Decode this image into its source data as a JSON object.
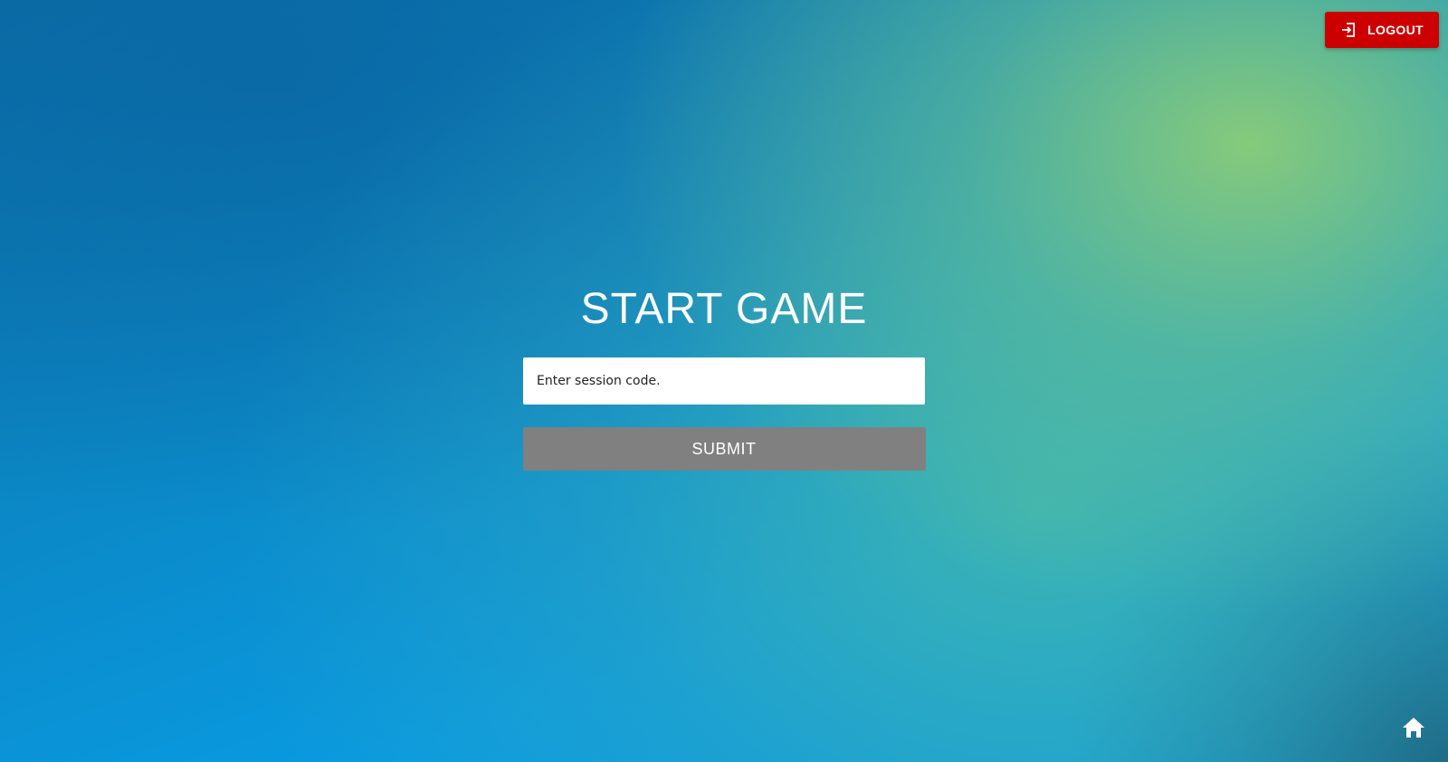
{
  "header": {
    "logout_label": "LOGOUT",
    "logout_icon": "logout-icon",
    "logout_color": "#cc0000"
  },
  "main": {
    "title": "START GAME",
    "session_input": {
      "placeholder": "Enter session code.",
      "value": ""
    },
    "submit_label": "SUBMIT",
    "submit_color": "#808080"
  },
  "footer": {
    "home_icon": "home-icon"
  }
}
